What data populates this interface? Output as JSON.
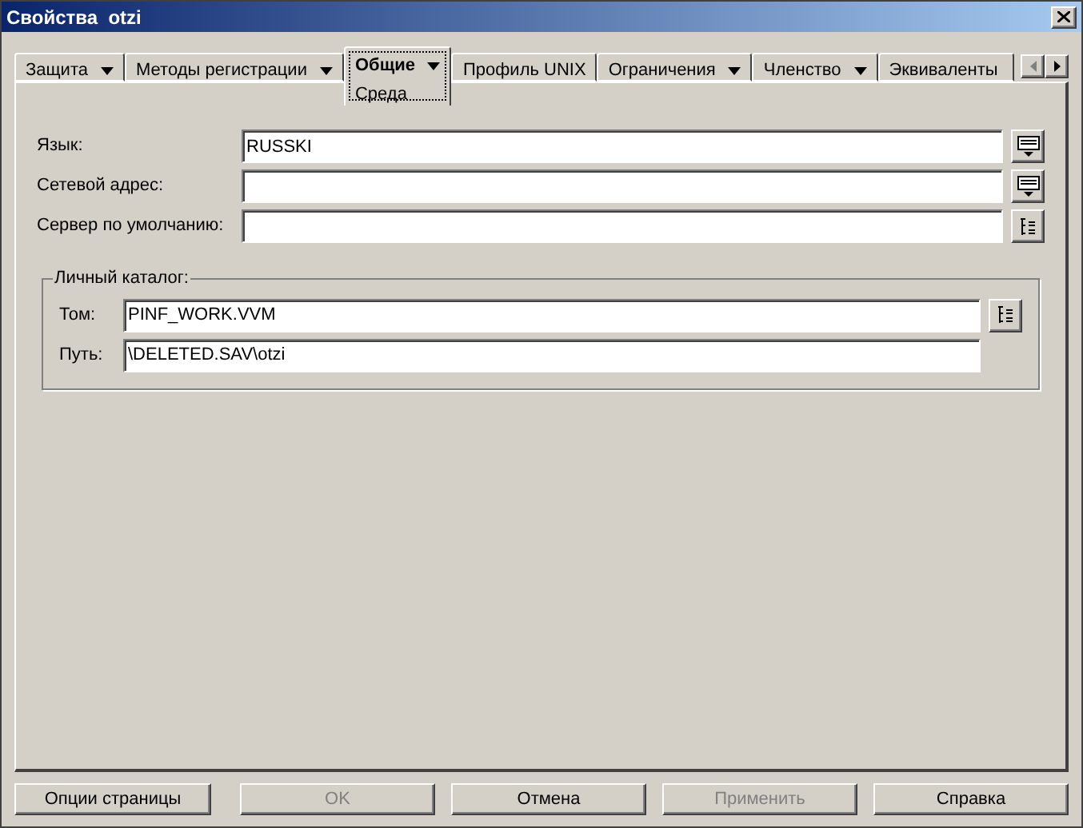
{
  "window": {
    "title": "Свойства  otzi"
  },
  "tabs": [
    {
      "label": "Защита",
      "has_menu": true,
      "selected": false
    },
    {
      "label": "Методы регистрации",
      "has_menu": true,
      "selected": false
    },
    {
      "label": "Общие",
      "has_menu": true,
      "selected": true,
      "subpage": "Среда"
    },
    {
      "label": "Профиль UNIX",
      "has_menu": false,
      "selected": false
    },
    {
      "label": "Ограничения",
      "has_menu": true,
      "selected": false
    },
    {
      "label": "Членство",
      "has_menu": true,
      "selected": false
    },
    {
      "label": "Эквиваленты",
      "has_menu": false,
      "selected": false
    }
  ],
  "fields": [
    {
      "label": "Язык:",
      "value": "RUSSKI",
      "kind": "list"
    },
    {
      "label": "Сетевой адрес:",
      "kind": "list"
    },
    {
      "label": "Сервер по умолчанию:",
      "kind": "browse"
    }
  ],
  "home_directory": {
    "title": "Личный каталог:",
    "fields": [
      {
        "label": "Том:",
        "value": "PINF_WORK.VVM",
        "kind": "browse"
      },
      {
        "label": "Путь:",
        "value": "\\DELETED.SAV\\otzi",
        "kind": "none"
      }
    ]
  },
  "buttons": [
    {
      "label": "Опции страницы",
      "disabled": false
    },
    {
      "label": "OK",
      "disabled": true
    },
    {
      "label": "Отмена",
      "disabled": false
    },
    {
      "label": "Применить",
      "disabled": true
    },
    {
      "label": "Справка",
      "disabled": false
    }
  ]
}
